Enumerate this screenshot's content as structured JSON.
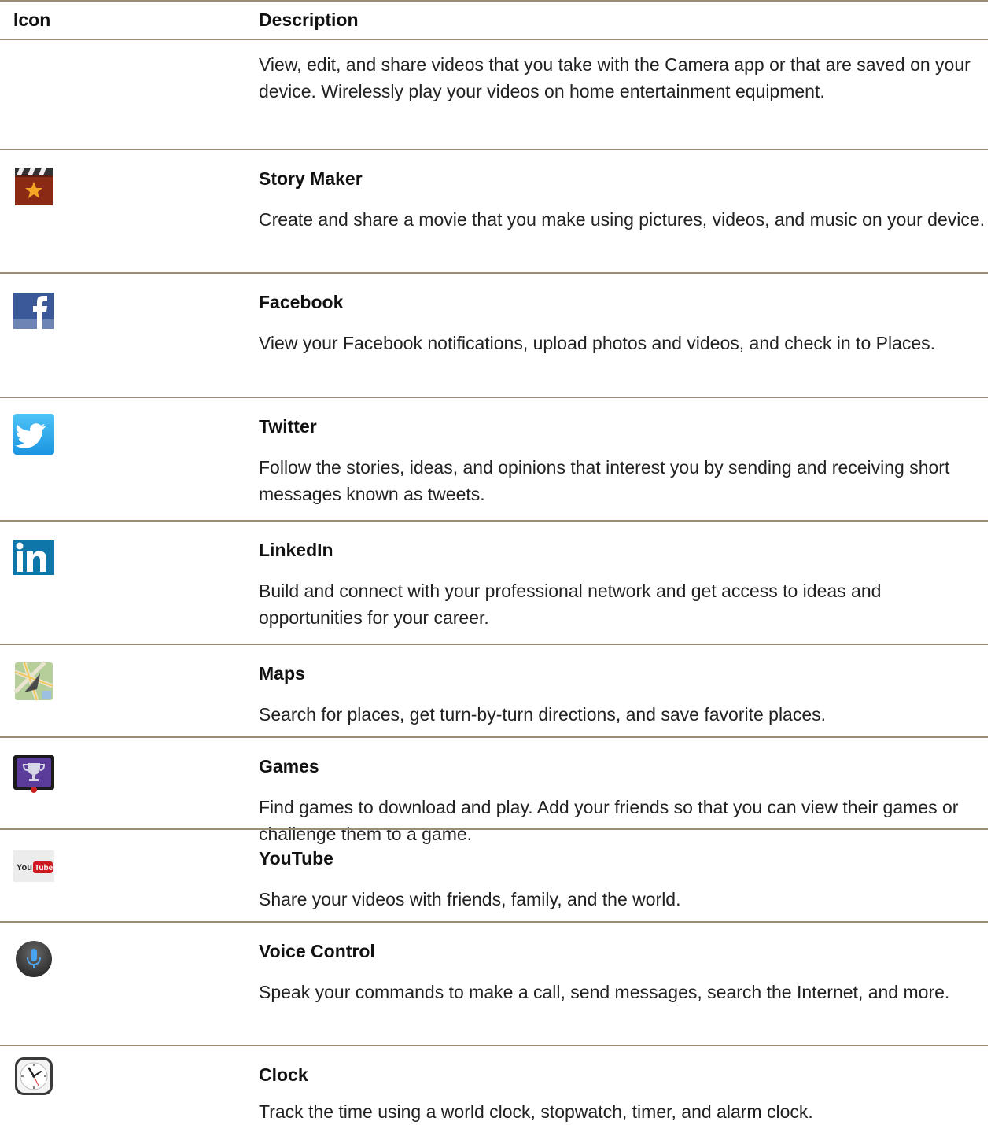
{
  "table": {
    "header": {
      "icon": "Icon",
      "description": "Description"
    },
    "intro_row": {
      "description": "View, edit, and share videos that you take with the Camera app or that are saved on your device. Wirelessly play your videos on home entertainment equipment."
    },
    "rows": [
      {
        "icon": "story-maker-icon",
        "name": "Story Maker",
        "description": "Create and share a movie that you make using pictures, videos, and music on your device."
      },
      {
        "icon": "facebook-icon",
        "name": "Facebook",
        "description": "View your Facebook notifications, upload photos and videos, and check in to Places."
      },
      {
        "icon": "twitter-icon",
        "name": "Twitter",
        "description": "Follow the stories, ideas, and opinions that interest you by sending and receiving short messages known as tweets."
      },
      {
        "icon": "linkedin-icon",
        "name": "LinkedIn",
        "description": "Build and connect with your professional network and get access to ideas and opportunities for your career."
      },
      {
        "icon": "maps-icon",
        "name": "Maps",
        "description": "Search for places, get turn-by-turn directions, and save favorite places."
      },
      {
        "icon": "games-icon",
        "name": "Games",
        "description": "Find games to download and play. Add your friends so that you can view their games or challenge them to a game."
      },
      {
        "icon": "youtube-icon",
        "name": "YouTube",
        "description": "Share your videos with friends, family, and the world."
      },
      {
        "icon": "voice-control-icon",
        "name": "Voice Control",
        "description": "Speak your commands to make a call, send messages, search the Internet, and more."
      },
      {
        "icon": "clock-icon",
        "name": "Clock",
        "description": "Track the time using a world clock, stopwatch, timer, and alarm clock."
      }
    ],
    "colors": {
      "rule": "#9b8c74",
      "text": "#222222"
    }
  }
}
